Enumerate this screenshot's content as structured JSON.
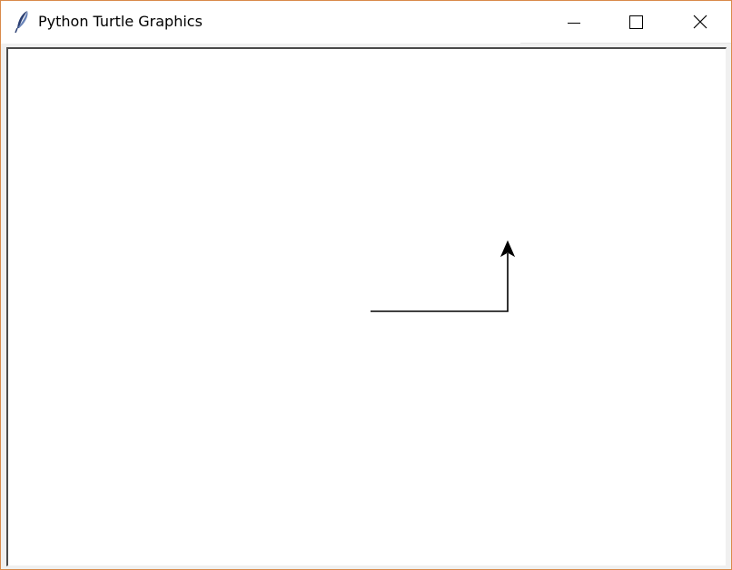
{
  "window": {
    "title": "Python Turtle Graphics",
    "app_icon": "feather-icon",
    "border_color": "#d98a4a"
  },
  "controls": {
    "minimize_icon": "minimize-icon",
    "maximize_icon": "maximize-icon",
    "close_icon": "close-icon"
  },
  "canvas": {
    "background": "#ffffff",
    "pen_color": "#000000",
    "turtle_shape": "arrow",
    "turtle_heading": "up",
    "path_segments": 2
  }
}
